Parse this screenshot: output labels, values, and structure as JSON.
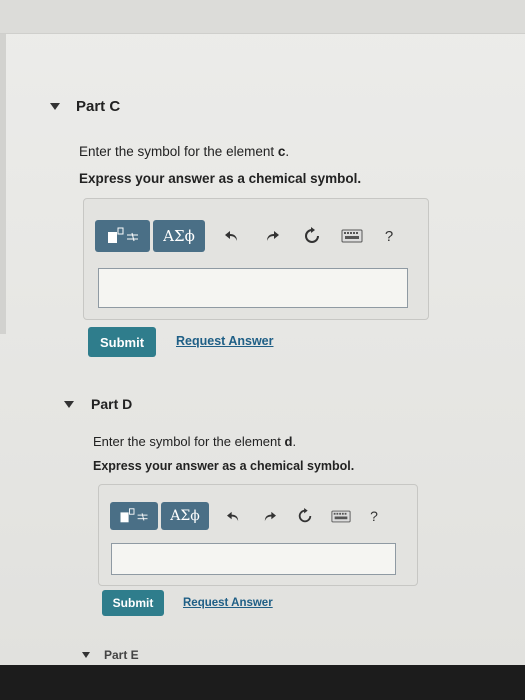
{
  "partC": {
    "title": "Part C",
    "prompt_prefix": "Enter the symbol for the element ",
    "prompt_var": "c",
    "prompt_suffix": ".",
    "instruction": "Express your answer as a chemical symbol.",
    "greek_label": "ΑΣϕ",
    "help_label": "?",
    "submit_label": "Submit",
    "request_label": "Request Answer",
    "answer_value": ""
  },
  "partD": {
    "title": "Part D",
    "prompt_prefix": "Enter the symbol for the element ",
    "prompt_var": "d",
    "prompt_suffix": ".",
    "instruction": "Express your answer as a chemical symbol.",
    "greek_label": "ΑΣϕ",
    "help_label": "?",
    "submit_label": "Submit",
    "request_label": "Request Answer",
    "answer_value": ""
  },
  "partE": {
    "title": "Part E"
  },
  "colors": {
    "toolbar_button": "#4a6f86",
    "submit_button": "#2f7d8c",
    "link": "#1f5f86"
  }
}
